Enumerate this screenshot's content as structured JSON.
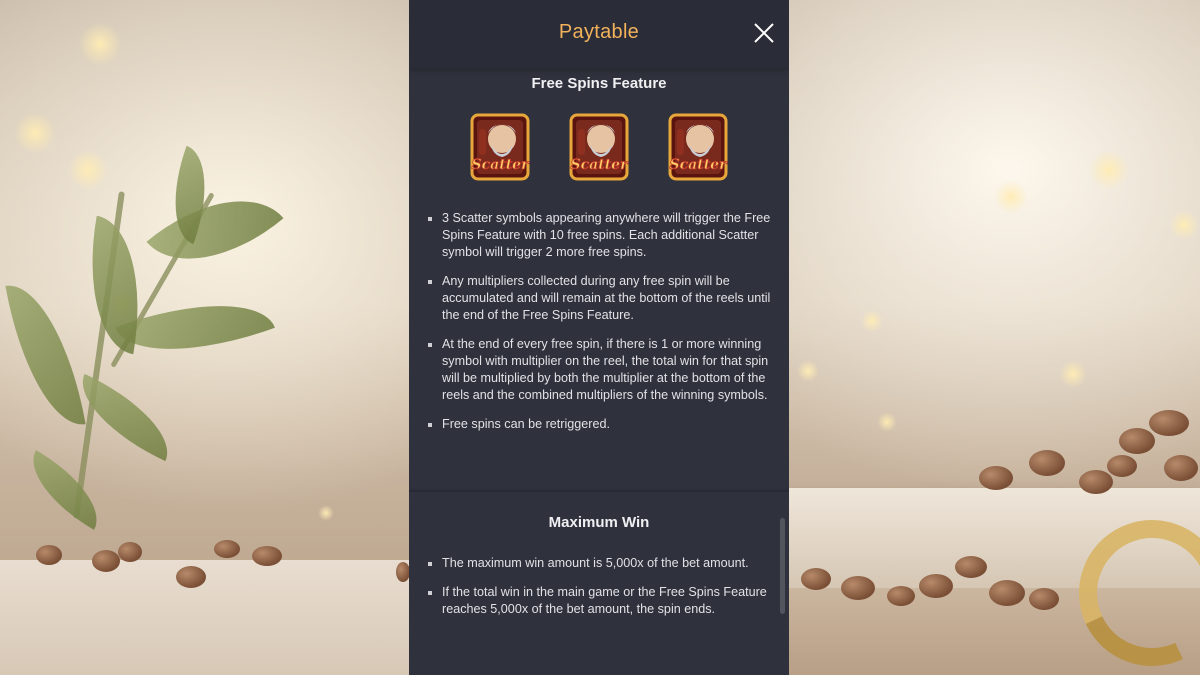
{
  "header": {
    "title": "Paytable",
    "close_icon": "close-icon"
  },
  "free_spins": {
    "title": "Free Spins Feature",
    "symbol_label": "Scatter",
    "symbol_count": 3,
    "rules": [
      "3 Scatter symbols appearing anywhere will trigger the Free Spins Feature with 10 free spins. Each additional Scatter symbol will trigger 2 more free spins.",
      "Any multipliers collected during any free spin will be accumulated and will remain at the bottom of the reels until the end of the Free Spins Feature.",
      "At the end of every free spin, if there is 1 or more winning symbol with multiplier on the reel, the total win for that spin will be multiplied by both the multiplier at the bottom of the reels and the combined multipliers of the winning symbols.",
      "Free spins can be retriggered."
    ]
  },
  "max_win": {
    "title": "Maximum Win",
    "rules": [
      "The maximum win amount is 5,000x of the bet amount.",
      "If the total win in the main game or the Free Spins Feature reaches 5,000x of the bet amount, the spin ends."
    ]
  },
  "colors": {
    "panel_bg": "#2d2f3a",
    "title_accent": "#f2b25c",
    "text": "#e2e2e6"
  }
}
